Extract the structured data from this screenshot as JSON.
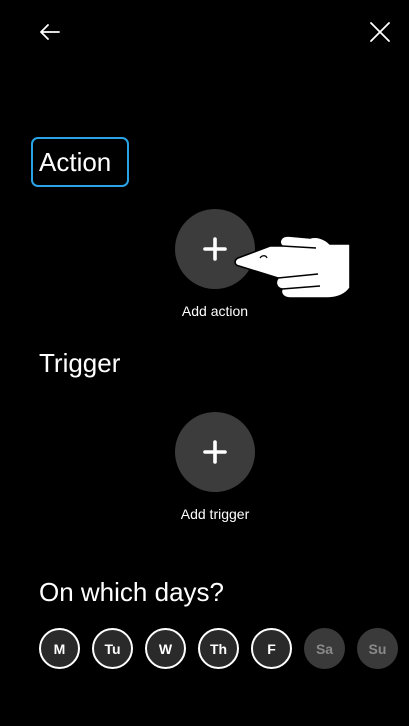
{
  "topbar": {
    "back_icon": "arrow-left-icon",
    "close_icon": "close-icon"
  },
  "action": {
    "title": "Action",
    "add_label": "Add action",
    "add_icon": "plus-icon"
  },
  "trigger": {
    "title": "Trigger",
    "add_label": "Add trigger",
    "add_icon": "plus-icon"
  },
  "days": {
    "title": "On which days?",
    "items": [
      {
        "label": "M",
        "selected": true
      },
      {
        "label": "Tu",
        "selected": true
      },
      {
        "label": "W",
        "selected": true
      },
      {
        "label": "Th",
        "selected": true
      },
      {
        "label": "F",
        "selected": true
      },
      {
        "label": "Sa",
        "selected": false
      },
      {
        "label": "Su",
        "selected": false
      }
    ]
  },
  "colors": {
    "background": "#000000",
    "focus_ring": "#29a3e6",
    "button_fill": "#3c3c3c"
  },
  "overlay": {
    "icon": "pointing-hand-icon"
  }
}
